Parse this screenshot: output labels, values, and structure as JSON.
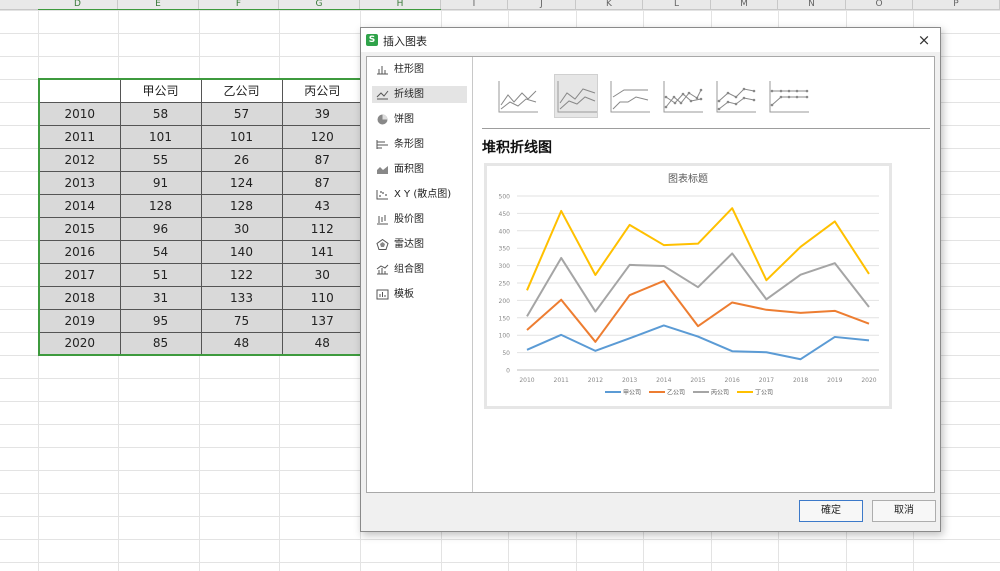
{
  "sheet": {
    "columns": [
      "D",
      "E",
      "F",
      "G",
      "H",
      "I",
      "J",
      "K",
      "L",
      "M",
      "N",
      "O",
      "P"
    ],
    "selected_columns": [
      "D",
      "E",
      "F",
      "G",
      "H"
    ],
    "table": {
      "header": [
        "",
        "甲公司",
        "乙公司",
        "丙公司"
      ],
      "rows": [
        [
          "2010",
          "58",
          "57",
          "39"
        ],
        [
          "2011",
          "101",
          "101",
          "120"
        ],
        [
          "2012",
          "55",
          "26",
          "87"
        ],
        [
          "2013",
          "91",
          "124",
          "87"
        ],
        [
          "2014",
          "128",
          "128",
          "43"
        ],
        [
          "2015",
          "96",
          "30",
          "112"
        ],
        [
          "2016",
          "54",
          "140",
          "141"
        ],
        [
          "2017",
          "51",
          "122",
          "30"
        ],
        [
          "2018",
          "31",
          "133",
          "110"
        ],
        [
          "2019",
          "95",
          "75",
          "137"
        ],
        [
          "2020",
          "85",
          "48",
          "48"
        ]
      ]
    }
  },
  "dialog": {
    "title": "插入图表",
    "app_icon": "spreadsheet-app-icon",
    "close": "×",
    "nav": [
      {
        "label": "柱形图",
        "icon": "column-chart-icon"
      },
      {
        "label": "折线图",
        "icon": "line-chart-icon",
        "active": true
      },
      {
        "label": "饼图",
        "icon": "pie-chart-icon"
      },
      {
        "label": "条形图",
        "icon": "bar-chart-icon"
      },
      {
        "label": "面积图",
        "icon": "area-chart-icon"
      },
      {
        "label": "X Y (散点图)",
        "icon": "scatter-chart-icon"
      },
      {
        "label": "股价图",
        "icon": "stock-chart-icon"
      },
      {
        "label": "雷达图",
        "icon": "radar-chart-icon"
      },
      {
        "label": "组合图",
        "icon": "combo-chart-icon"
      },
      {
        "label": "模板",
        "icon": "template-icon"
      }
    ],
    "subtypes": [
      {
        "name": "line-subtype-icon"
      },
      {
        "name": "stacked-line-subtype-icon",
        "active": true
      },
      {
        "name": "percent-stacked-line-subtype-icon"
      },
      {
        "name": "line-markers-subtype-icon"
      },
      {
        "name": "stacked-line-markers-subtype-icon"
      },
      {
        "name": "percent-stacked-line-markers-subtype-icon"
      }
    ],
    "chart_type_title": "堆积折线图",
    "ok_label": "確定",
    "cancel_label": "取消"
  },
  "chart_data": {
    "type": "line",
    "title": "图表标题",
    "stacked": true,
    "categories": [
      "2010",
      "2011",
      "2012",
      "2013",
      "2014",
      "2015",
      "2016",
      "2017",
      "2018",
      "2019",
      "2020"
    ],
    "series": [
      {
        "name": "甲公司",
        "color": "#5b9bd5",
        "values": [
          58,
          101,
          55,
          91,
          128,
          96,
          54,
          51,
          31,
          95,
          85
        ]
      },
      {
        "name": "乙公司",
        "color": "#ed7d31",
        "values": [
          57,
          101,
          26,
          124,
          128,
          30,
          140,
          122,
          133,
          75,
          48
        ]
      },
      {
        "name": "丙公司",
        "color": "#a5a5a5",
        "values": [
          39,
          120,
          87,
          87,
          43,
          112,
          141,
          30,
          110,
          137,
          48
        ]
      },
      {
        "name": "丁公司",
        "color": "#ffc000",
        "values": [
          75,
          135,
          105,
          115,
          60,
          125,
          130,
          55,
          80,
          120,
          95
        ]
      }
    ],
    "ylim": [
      0,
      500
    ],
    "yticks": [
      0,
      50,
      100,
      150,
      200,
      250,
      300,
      350,
      400,
      450,
      500
    ],
    "grid": true,
    "legend": "bottom"
  }
}
